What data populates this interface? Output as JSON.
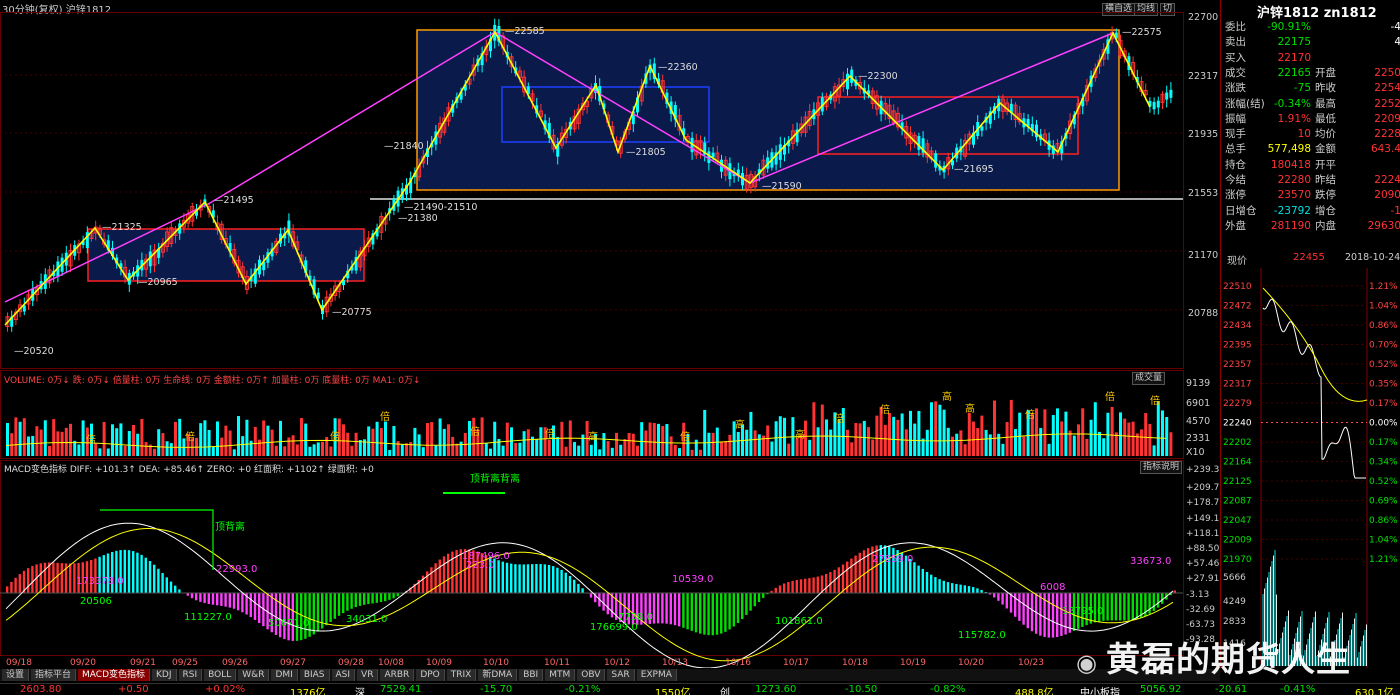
{
  "window": {
    "title": "30分钟(复权) 沪锌1812",
    "buttons": [
      "横自选",
      "均线",
      "切"
    ]
  },
  "colors": {
    "up": "#ff3333",
    "down": "#00ffff",
    "zig": "#ffff00",
    "trend": "#ff40ff",
    "box": "#ff0000"
  },
  "price_axis": [
    "22700",
    "22317",
    "21935",
    "21553",
    "21170",
    "20788"
  ],
  "price_labels": [
    "22585",
    "22575",
    "22360",
    "22300",
    "21840",
    "21805",
    "21590",
    "21695",
    "21495",
    "21325",
    "20965",
    "20775",
    "20520",
    "21380",
    "21490-21510"
  ],
  "volume_panel": {
    "legend": "VOLUME: 0万↓ 跌: 0万↓ 倍量柱: 0万 生命线: 0万 金额柱: 0万↑ 加量柱: 0万 底量柱: 0万 MA1: 0万↓",
    "button": "成交量",
    "axis": [
      "9139",
      "6901",
      "4570",
      "2331",
      "X10"
    ],
    "markers": [
      "倍",
      "倍",
      "倍",
      "倍",
      "倍",
      "倍",
      "高",
      "倍",
      "高",
      "高",
      "倍",
      "倍",
      "高",
      "高",
      "倍",
      "倍",
      "倍"
    ]
  },
  "macd_panel": {
    "legend": "MACD变色指标 DIFF: +101.3↑ DEA: +85.46↑ ZERO: +0 红面积: +1102↑ 绿面积: +0",
    "button": "指标说明",
    "axis": [
      "+239.3",
      "+209.7",
      "+178.7",
      "+149.1",
      "+118.1",
      "+88.50",
      "+57.46",
      "+27.91",
      "-3.13",
      "-32.69",
      "-63.73",
      "-93.28"
    ],
    "annotations": [
      "顶背离",
      "顶背离背离",
      "173378.0",
      "20506",
      "111227.0",
      "50671.0",
      "34031.0",
      "187496.0",
      "223.0",
      "176699.0",
      "7738.0",
      "101861.0",
      "13795.0",
      "115782.0",
      "33673.0",
      "27859.0",
      "10539.0",
      "6008",
      "22993.0"
    ]
  },
  "dates": [
    "09/18",
    "09/20",
    "09/21",
    "09/25",
    "09/26",
    "09/27",
    "09/28",
    "10/08",
    "10/09",
    "10/10",
    "10/11",
    "10/12",
    "10/13",
    "10/16",
    "10/17",
    "10/18",
    "10/19",
    "10/20",
    "10/23"
  ],
  "tabs": [
    "设置",
    "指标平台",
    "MACD变色指标",
    "KDJ",
    "RSI",
    "BOLL",
    "W&R",
    "DMI",
    "BIAS",
    "ASI",
    "VR",
    "ARBR",
    "DPO",
    "TRIX",
    "新DMA",
    "BBI",
    "MTM",
    "OBV",
    "SAR",
    "EXPMA"
  ],
  "status": {
    "a": "2603.80",
    "b": "+0.50",
    "c": "+0.02%",
    "d": "1376亿",
    "e": "深",
    "f": "7529.41",
    "g": "-15.70",
    "h": "-0.21%",
    "i": "1550亿",
    "j": "创",
    "k": "1273.60",
    "l": "-10.50",
    "m": "-0.82%",
    "n": "488.8亿",
    "o": "中小板指",
    "p": "5056.92",
    "q": "-20.61",
    "r": "-0.41%",
    "s": "630.1亿"
  },
  "watermark": "黄磊的期货人生",
  "quote": {
    "title": "沪锌1812 zn1812",
    "rows": [
      {
        "l": "委比",
        "v": "-90.91%",
        "l2": "",
        "v2": "-4"
      },
      {
        "l": "卖出",
        "v": "22175",
        "l2": "",
        "v2": "4"
      },
      {
        "l": "买入",
        "v": "22170",
        "l2": "",
        "v2": ""
      },
      {
        "l": "成交",
        "v": "22165",
        "l2": "开盘",
        "v2": "2250"
      },
      {
        "l": "涨跌",
        "v": "-75",
        "l2": "昨收",
        "v2": "2254"
      },
      {
        "l": "涨幅(结)",
        "v": "-0.34%",
        "l2": "最高",
        "v2": "2252"
      },
      {
        "l": "振幅",
        "v": "1.91%",
        "l2": "最低",
        "v2": "2209"
      },
      {
        "l": "现手",
        "v": "10",
        "l2": "均价",
        "v2": "2228"
      },
      {
        "l": "总手",
        "v": "577,498",
        "l2": "金额",
        "v2": "643.4"
      },
      {
        "l": "持仓",
        "v": "180418",
        "l2": "开平",
        "v2": ""
      },
      {
        "l": "今结",
        "v": "22280",
        "l2": "昨结",
        "v2": "2224"
      },
      {
        "l": "涨停",
        "v": "23570",
        "l2": "跌停",
        "v2": "2090"
      },
      {
        "l": "日增仓",
        "v": "-23792",
        "l2": "增仓",
        "v2": "-1"
      },
      {
        "l": "外盘",
        "v": "281190",
        "l2": "内盘",
        "v2": "29630"
      }
    ],
    "now_label": "现价",
    "now_value": "22455",
    "now_time": "2018-10-24,3",
    "intraday_axis": [
      "22510",
      "22472",
      "22434",
      "22395",
      "22357",
      "22317",
      "22279",
      "22240",
      "22202",
      "22164",
      "22125",
      "22087",
      "22047",
      "22009",
      "21970"
    ],
    "intraday_pct": [
      "1.21%",
      "1.04%",
      "0.86%",
      "0.70%",
      "0.52%",
      "0.35%",
      "0.17%",
      "0.00%",
      "0.17%",
      "0.34%",
      "0.52%",
      "0.69%",
      "0.86%",
      "1.04%",
      "1.21%"
    ],
    "vol_axis": [
      "5666",
      "4249",
      "2833",
      "1416"
    ]
  }
}
